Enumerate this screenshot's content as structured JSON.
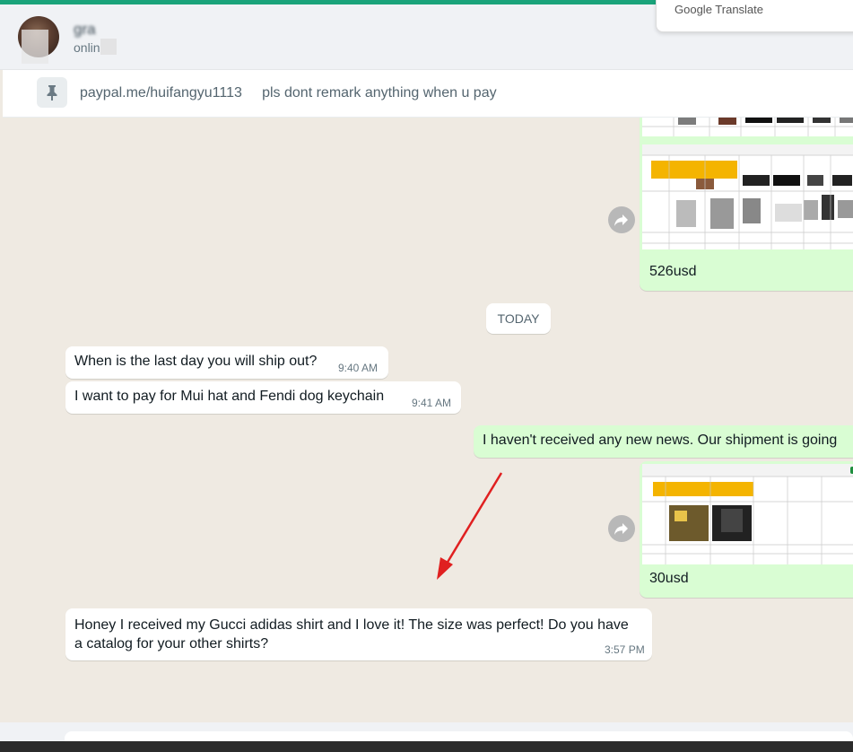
{
  "contact": {
    "name": "gra",
    "status": "onlin"
  },
  "translate": {
    "label": "Google Translate"
  },
  "pinned": {
    "text": "paypal.me/huifangyu1113     pls dont remark anything when u pay"
  },
  "date_divider": "TODAY",
  "messages": [
    {
      "text": "526usd"
    },
    {
      "text": "When is the last day you will ship out?",
      "time": "9:40 AM"
    },
    {
      "text": "I want to pay for Mui hat and Fendi dog keychain",
      "time": "9:41 AM"
    },
    {
      "text": "I haven't received any new news. Our shipment is going"
    },
    {
      "text": "30usd"
    },
    {
      "text": "Honey I received my Gucci adidas shirt and I love it! The size was perfect! Do you have a catalog for your other shirts?",
      "time": "3:57 PM"
    }
  ],
  "colors": {
    "accent": "#1aa37a",
    "outgoing": "#d9fdd3",
    "arrow": "#e02020"
  }
}
